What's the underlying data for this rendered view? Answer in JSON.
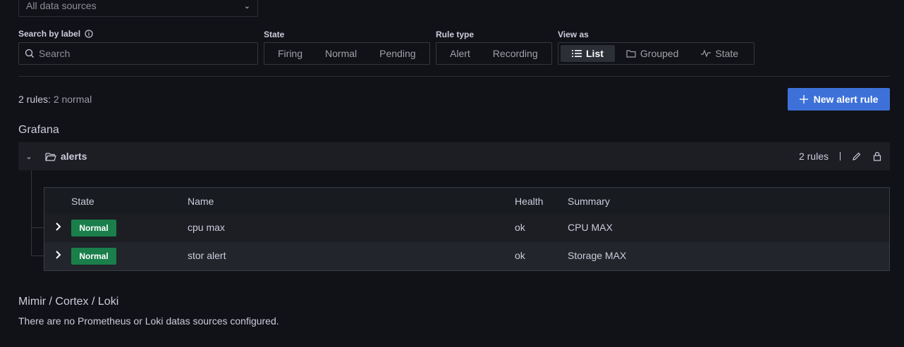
{
  "filters": {
    "datasource_value": "All data sources",
    "search_label": "Search by label",
    "search_placeholder": "Search",
    "state_label": "State",
    "state_options": [
      "Firing",
      "Normal",
      "Pending"
    ],
    "rule_type_label": "Rule type",
    "rule_type_options": [
      "Alert",
      "Recording"
    ],
    "view_as_label": "View as",
    "view_as_options": [
      "List",
      "Grouped",
      "State"
    ],
    "view_as_selected": "List"
  },
  "summary": {
    "prefix": "2 rules:",
    "detail": "2 normal"
  },
  "new_rule_button": "New alert rule",
  "grafana_section": {
    "title": "Grafana",
    "folder_name": "alerts",
    "rule_count": "2 rules",
    "columns": [
      "State",
      "Name",
      "Health",
      "Summary"
    ],
    "rows": [
      {
        "state": "Normal",
        "name": "cpu max",
        "health": "ok",
        "summary": "CPU MAX"
      },
      {
        "state": "Normal",
        "name": "stor alert",
        "health": "ok",
        "summary": "Storage MAX"
      }
    ]
  },
  "mimir_section": {
    "title": "Mimir / Cortex / Loki",
    "message": "There are no Prometheus or Loki datas sources configured."
  },
  "colors": {
    "background": "#111217",
    "primary_button": "#3d71d9",
    "normal_badge": "#1a7f4b"
  }
}
